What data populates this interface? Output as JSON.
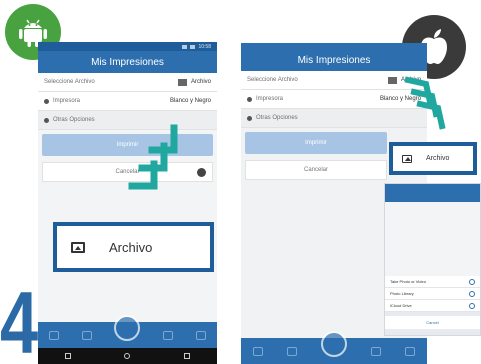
{
  "step_number": "4",
  "colors": {
    "accent_teal": "#20a7a0",
    "brand_blue": "#1f5d9a",
    "android_green": "#48a23f"
  },
  "brand_icons": [
    "android-icon",
    "apple-icon"
  ],
  "android": {
    "status_time": "10:58",
    "app_title": "Mis Impresiones",
    "rows": [
      {
        "label": "Seleccione Archivo",
        "value": "Archivo"
      },
      {
        "label": "Impresora",
        "value": "Blanco y Negro"
      },
      {
        "label": "Otras Opciones",
        "value": ""
      }
    ],
    "print_button": "Imprimir",
    "cancel_button": "Cancelar",
    "callout_label": "Archivo"
  },
  "ios": {
    "app_title": "Mis Impresiones",
    "rows": [
      {
        "label": "Seleccione Archivo",
        "value": "Archivo"
      },
      {
        "label": "Impresora",
        "value": "Blanco y Negro"
      },
      {
        "label": "Otras Opciones",
        "value": ""
      }
    ],
    "print_button": "Imprimir",
    "cancel_button": "Cancelar",
    "callout_label": "Archivo",
    "sheet": {
      "options": [
        "Take Photo or Video",
        "Photo Library",
        "iCloud Drive"
      ],
      "cancel": "Cancel"
    }
  }
}
